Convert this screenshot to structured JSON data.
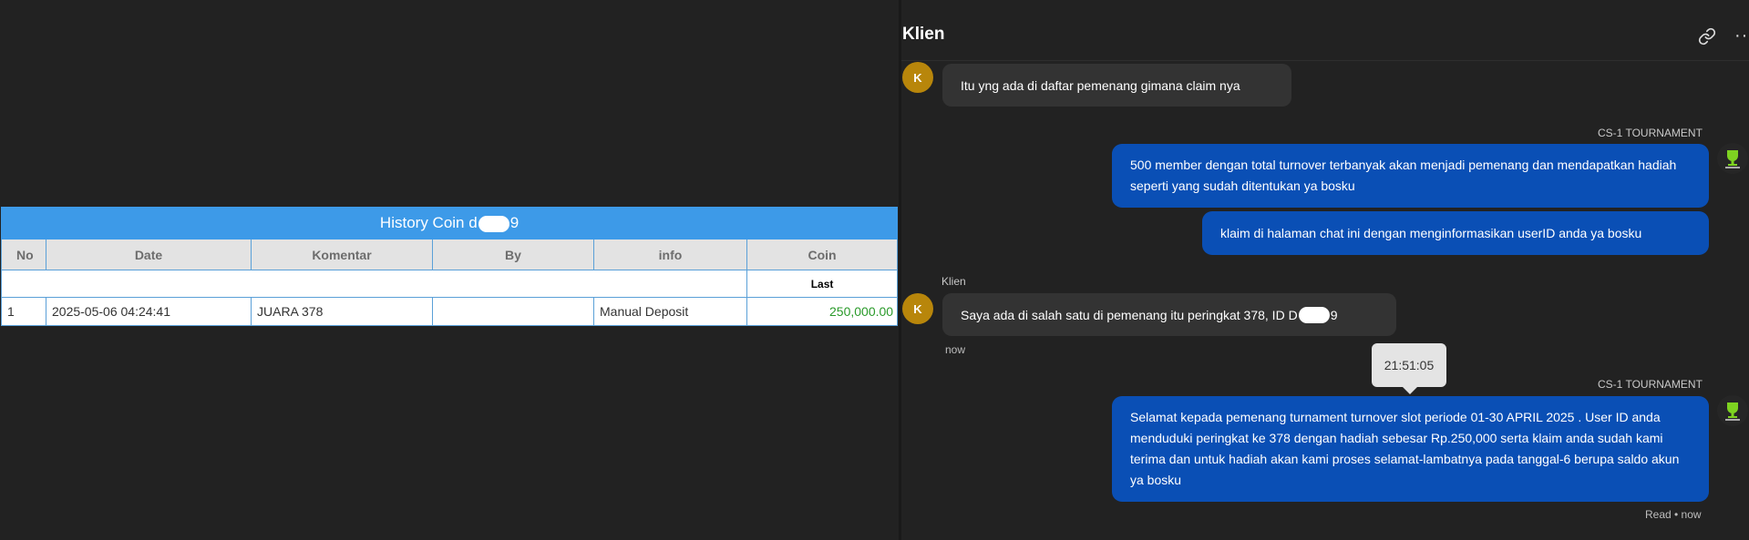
{
  "history": {
    "title_prefix": "History Coin d",
    "title_suffix": "9",
    "columns": [
      "No",
      "Date",
      "Komentar",
      "By",
      "info",
      "Coin"
    ],
    "sub_header": "Last",
    "rows": [
      {
        "no": "1",
        "date": "2025-05-06 04:24:41",
        "komentar": "JUARA 378",
        "by": "",
        "info": "Manual Deposit",
        "coin": "250,000.00"
      }
    ],
    "colors": {
      "title_bg": "#3d9ae8",
      "amount": "#2a9a2a"
    }
  },
  "chat": {
    "title": "Klien",
    "header_icons": [
      "link-icon",
      "more-icon"
    ],
    "avatar_initial": "K",
    "messages": {
      "m1": {
        "sender": "Klien",
        "text": "Itu yng ada di daftar pemenang gimana claim nya"
      },
      "m2_sender": "CS-1 TOURNAMENT",
      "m2": {
        "text": "500 member dengan total turnover terbanyak akan menjadi pemenang dan mendapatkan hadiah seperti yang sudah ditentukan ya bosku"
      },
      "m3": {
        "text": "klaim di halaman chat ini dengan menginformasikan userID anda ya bosku"
      },
      "m4": {
        "sender": "Klien",
        "text_prefix": "Saya ada di salah satu di pemenang itu peringkat 378, ID D",
        "text_suffix": "9",
        "time": "now"
      },
      "tooltip_time": "21:51:05",
      "m5_sender": "CS-1 TOURNAMENT",
      "m5": {
        "text": "Selamat kepada pemenang turnament turnover slot periode 01-30 APRIL 2025 . User ID anda menduduki peringkat ke 378 dengan hadiah sebesar Rp.250,000 serta klaim anda sudah kami terima dan untuk hadiah akan kami proses selamat-lambatnya pada tanggal-6 berupa saldo akun ya bosku",
        "status": "Read • now"
      }
    },
    "colors": {
      "bubble_out": "#0a4fb5",
      "bubble_in": "#333333",
      "avatar": "#b8860b"
    }
  }
}
